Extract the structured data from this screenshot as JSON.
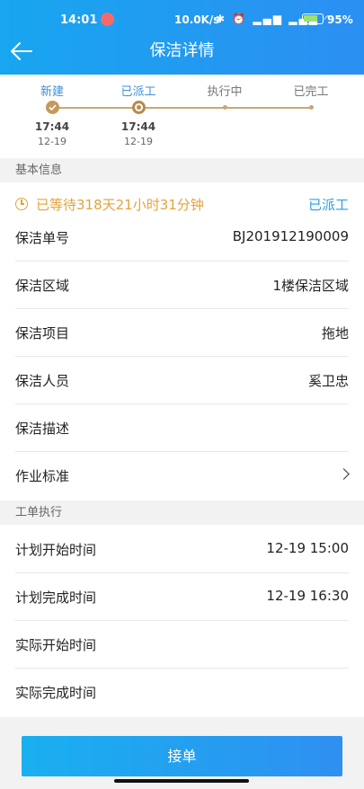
{
  "status_bar": {
    "time": "14:01",
    "net_speed": "10.0K/s",
    "signal_icons": "✱ ⏰ ▂▄▆ ▂▄▆ ◠",
    "battery_pct": "95%"
  },
  "header": {
    "title": "保洁详情",
    "back_icon": "back-arrow-icon"
  },
  "progress": {
    "steps": [
      {
        "label": "新建",
        "state": "done",
        "time": "17:44",
        "date": "12-19"
      },
      {
        "label": "已派工",
        "state": "current",
        "time": "17:44",
        "date": "12-19"
      },
      {
        "label": "执行中",
        "state": "todo"
      },
      {
        "label": "已完工",
        "state": "todo"
      }
    ]
  },
  "basic_info": {
    "section_title": "基本信息",
    "wait_text": "已等待318天21小时31分钟",
    "status": "已派工",
    "rows": [
      {
        "label": "保洁单号",
        "value": "BJ201912190009"
      },
      {
        "label": "保洁区域",
        "value": "1楼保洁区域"
      },
      {
        "label": "保洁项目",
        "value": "拖地"
      },
      {
        "label": "保洁人员",
        "value": "奚卫忠"
      },
      {
        "label": "保洁描述",
        "value": ""
      },
      {
        "label": "作业标准",
        "value": ""
      }
    ]
  },
  "execution": {
    "section_title": "工单执行",
    "rows": [
      {
        "label": "计划开始时间",
        "value": "12-19 15:00"
      },
      {
        "label": "计划完成时间",
        "value": "12-19 16:30"
      },
      {
        "label": "实际开始时间",
        "value": ""
      },
      {
        "label": "实际完成时间",
        "value": ""
      }
    ]
  },
  "footer": {
    "accept_label": "接单"
  },
  "colors": {
    "primary": "#2a9fe3",
    "warning": "#e3a33a",
    "progress_gold": "#c49a5a"
  }
}
